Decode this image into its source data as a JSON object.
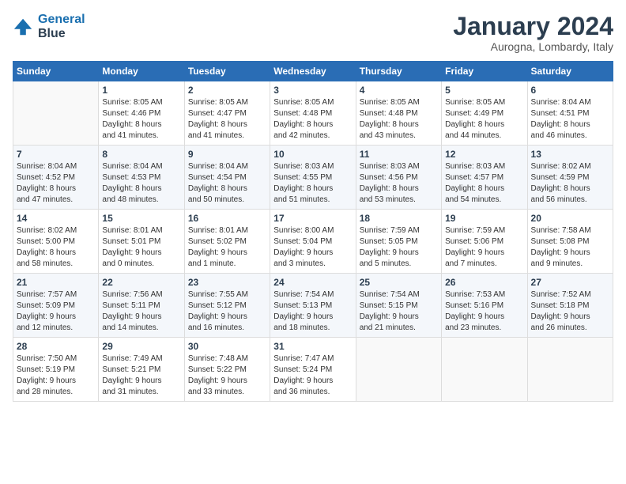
{
  "header": {
    "logo_line1": "General",
    "logo_line2": "Blue",
    "month": "January 2024",
    "location": "Aurogna, Lombardy, Italy"
  },
  "weekdays": [
    "Sunday",
    "Monday",
    "Tuesday",
    "Wednesday",
    "Thursday",
    "Friday",
    "Saturday"
  ],
  "weeks": [
    [
      {
        "day": "",
        "info": ""
      },
      {
        "day": "1",
        "info": "Sunrise: 8:05 AM\nSunset: 4:46 PM\nDaylight: 8 hours\nand 41 minutes."
      },
      {
        "day": "2",
        "info": "Sunrise: 8:05 AM\nSunset: 4:47 PM\nDaylight: 8 hours\nand 41 minutes."
      },
      {
        "day": "3",
        "info": "Sunrise: 8:05 AM\nSunset: 4:48 PM\nDaylight: 8 hours\nand 42 minutes."
      },
      {
        "day": "4",
        "info": "Sunrise: 8:05 AM\nSunset: 4:48 PM\nDaylight: 8 hours\nand 43 minutes."
      },
      {
        "day": "5",
        "info": "Sunrise: 8:05 AM\nSunset: 4:49 PM\nDaylight: 8 hours\nand 44 minutes."
      },
      {
        "day": "6",
        "info": "Sunrise: 8:04 AM\nSunset: 4:51 PM\nDaylight: 8 hours\nand 46 minutes."
      }
    ],
    [
      {
        "day": "7",
        "info": "Sunrise: 8:04 AM\nSunset: 4:52 PM\nDaylight: 8 hours\nand 47 minutes."
      },
      {
        "day": "8",
        "info": "Sunrise: 8:04 AM\nSunset: 4:53 PM\nDaylight: 8 hours\nand 48 minutes."
      },
      {
        "day": "9",
        "info": "Sunrise: 8:04 AM\nSunset: 4:54 PM\nDaylight: 8 hours\nand 50 minutes."
      },
      {
        "day": "10",
        "info": "Sunrise: 8:03 AM\nSunset: 4:55 PM\nDaylight: 8 hours\nand 51 minutes."
      },
      {
        "day": "11",
        "info": "Sunrise: 8:03 AM\nSunset: 4:56 PM\nDaylight: 8 hours\nand 53 minutes."
      },
      {
        "day": "12",
        "info": "Sunrise: 8:03 AM\nSunset: 4:57 PM\nDaylight: 8 hours\nand 54 minutes."
      },
      {
        "day": "13",
        "info": "Sunrise: 8:02 AM\nSunset: 4:59 PM\nDaylight: 8 hours\nand 56 minutes."
      }
    ],
    [
      {
        "day": "14",
        "info": "Sunrise: 8:02 AM\nSunset: 5:00 PM\nDaylight: 8 hours\nand 58 minutes."
      },
      {
        "day": "15",
        "info": "Sunrise: 8:01 AM\nSunset: 5:01 PM\nDaylight: 9 hours\nand 0 minutes."
      },
      {
        "day": "16",
        "info": "Sunrise: 8:01 AM\nSunset: 5:02 PM\nDaylight: 9 hours\nand 1 minute."
      },
      {
        "day": "17",
        "info": "Sunrise: 8:00 AM\nSunset: 5:04 PM\nDaylight: 9 hours\nand 3 minutes."
      },
      {
        "day": "18",
        "info": "Sunrise: 7:59 AM\nSunset: 5:05 PM\nDaylight: 9 hours\nand 5 minutes."
      },
      {
        "day": "19",
        "info": "Sunrise: 7:59 AM\nSunset: 5:06 PM\nDaylight: 9 hours\nand 7 minutes."
      },
      {
        "day": "20",
        "info": "Sunrise: 7:58 AM\nSunset: 5:08 PM\nDaylight: 9 hours\nand 9 minutes."
      }
    ],
    [
      {
        "day": "21",
        "info": "Sunrise: 7:57 AM\nSunset: 5:09 PM\nDaylight: 9 hours\nand 12 minutes."
      },
      {
        "day": "22",
        "info": "Sunrise: 7:56 AM\nSunset: 5:11 PM\nDaylight: 9 hours\nand 14 minutes."
      },
      {
        "day": "23",
        "info": "Sunrise: 7:55 AM\nSunset: 5:12 PM\nDaylight: 9 hours\nand 16 minutes."
      },
      {
        "day": "24",
        "info": "Sunrise: 7:54 AM\nSunset: 5:13 PM\nDaylight: 9 hours\nand 18 minutes."
      },
      {
        "day": "25",
        "info": "Sunrise: 7:54 AM\nSunset: 5:15 PM\nDaylight: 9 hours\nand 21 minutes."
      },
      {
        "day": "26",
        "info": "Sunrise: 7:53 AM\nSunset: 5:16 PM\nDaylight: 9 hours\nand 23 minutes."
      },
      {
        "day": "27",
        "info": "Sunrise: 7:52 AM\nSunset: 5:18 PM\nDaylight: 9 hours\nand 26 minutes."
      }
    ],
    [
      {
        "day": "28",
        "info": "Sunrise: 7:50 AM\nSunset: 5:19 PM\nDaylight: 9 hours\nand 28 minutes."
      },
      {
        "day": "29",
        "info": "Sunrise: 7:49 AM\nSunset: 5:21 PM\nDaylight: 9 hours\nand 31 minutes."
      },
      {
        "day": "30",
        "info": "Sunrise: 7:48 AM\nSunset: 5:22 PM\nDaylight: 9 hours\nand 33 minutes."
      },
      {
        "day": "31",
        "info": "Sunrise: 7:47 AM\nSunset: 5:24 PM\nDaylight: 9 hours\nand 36 minutes."
      },
      {
        "day": "",
        "info": ""
      },
      {
        "day": "",
        "info": ""
      },
      {
        "day": "",
        "info": ""
      }
    ]
  ]
}
